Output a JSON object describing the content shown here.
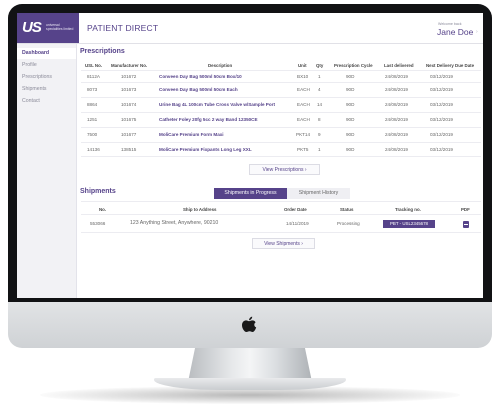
{
  "header": {
    "logo_mark": "US",
    "logo_text": "universal specialities limited",
    "title": "PATIENT DIRECT",
    "welcome": "Welcome back",
    "user_name": "Jane Doe",
    "user_chevron": "›"
  },
  "sidebar": {
    "items": [
      {
        "label": "Dashboard",
        "active": true
      },
      {
        "label": "Profile"
      },
      {
        "label": "Prescriptions"
      },
      {
        "label": "Shipments"
      },
      {
        "label": "Contact"
      }
    ]
  },
  "prescriptions": {
    "title": "Prescriptions",
    "columns": [
      "USL No.",
      "Manufacturer No.",
      "Description",
      "Unit",
      "Qty",
      "Prescription Cycle",
      "Last delivered",
      "Next Delivery Due Date"
    ],
    "rows": [
      [
        "8112A",
        "101672",
        "Conveen Day Bag 500ml 50cm Box/10",
        "BX10",
        "1",
        "90D",
        "24/08/2019",
        "03/12/2019"
      ],
      [
        "8073",
        "101673",
        "Conveen Day Bag 500ml 50cm Each",
        "EACH",
        "4",
        "90D",
        "24/08/2019",
        "03/12/2019"
      ],
      [
        "8864",
        "101674",
        "Urine Bag 4L 100cm Tube Cross Valve w/Sample Port",
        "EACH",
        "14",
        "90D",
        "24/08/2019",
        "03/12/2019"
      ],
      [
        "1251",
        "101675",
        "Catheter Foley 20fg 5cc 2 way Band 12350CE",
        "EACH",
        "8",
        "90D",
        "24/08/2019",
        "03/12/2019"
      ],
      [
        "7500",
        "101677",
        "MoliCare Premium Form Maxi",
        "PKT14",
        "9",
        "90D",
        "24/08/2019",
        "03/12/2019"
      ],
      [
        "14136",
        "138515",
        "MoliCare Premium Fixpants Long Leg XXL",
        "PKT5",
        "1",
        "90D",
        "24/08/2019",
        "03/12/2019"
      ]
    ],
    "view_button": "View Prescriptions  ›"
  },
  "shipments": {
    "title": "Shipments",
    "tabs": {
      "active": "Shipments in Progress",
      "other": "Shipment History"
    },
    "columns": [
      "No.",
      "Ship to Address",
      "Order Date",
      "Status",
      "Tracking no.",
      "PDF"
    ],
    "rows": [
      {
        "no": "553066",
        "address": "123 Anything Street, Anywhere, 90210",
        "order_date": "14/11/2019",
        "status": "Processing",
        "tracking": "PBT - USL2345678"
      }
    ],
    "view_button": "View Shipments  ›"
  },
  "icons": {
    "pdf": "pdf-download-icon",
    "apple": "apple-logo-icon"
  },
  "colors": {
    "brand": "#56438a",
    "bezel": "#111214"
  }
}
